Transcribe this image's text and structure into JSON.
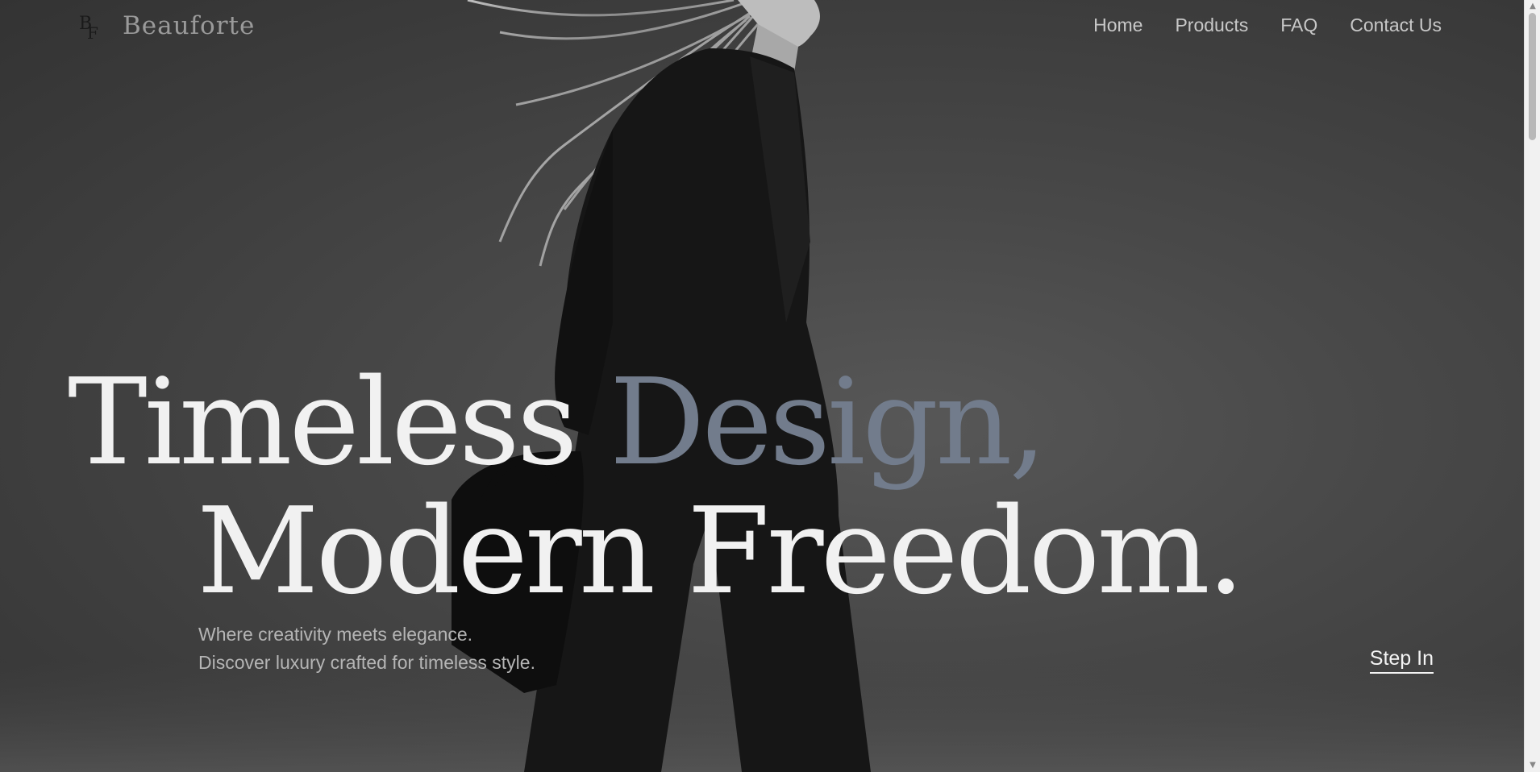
{
  "brand": {
    "name": "Beauforte",
    "monogram": "BF"
  },
  "nav": {
    "items": [
      "Home",
      "Products",
      "FAQ",
      "Contact Us"
    ]
  },
  "hero": {
    "line1_part1": "Timeless ",
    "line1_accent": "Design,",
    "line2": "Modern Freedom.",
    "subtitle_line1": "Where creativity meets elegance.",
    "subtitle_line2": "Discover luxury crafted for timeless style.",
    "cta": "Step In"
  },
  "colors": {
    "accent": "#727c8c",
    "headline": "#f1f1f1",
    "nav_text": "#c8c8c8",
    "background": "#494949"
  },
  "icons": {
    "scroll_up": "triangle-up-icon",
    "scroll_down": "triangle-down-icon"
  }
}
